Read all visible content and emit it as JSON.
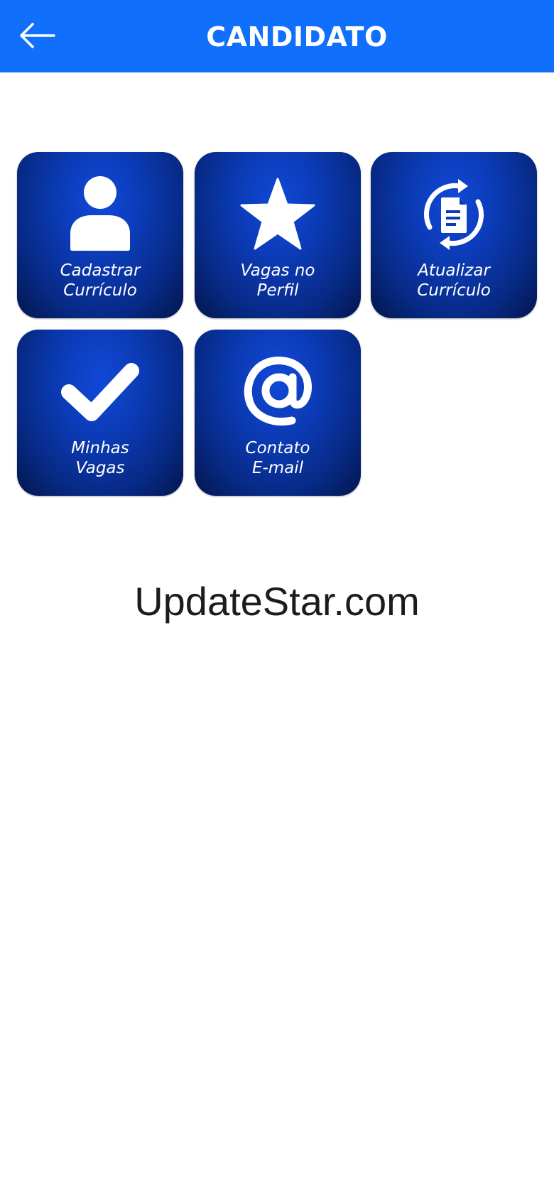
{
  "header": {
    "title": "CANDIDATO",
    "back_icon": "arrow-left-icon",
    "background_color": "#1070fb"
  },
  "tiles": [
    {
      "icon": "user-icon",
      "line1": "Cadastrar",
      "line2": "Currículo"
    },
    {
      "icon": "star-icon",
      "line1": "Vagas no",
      "line2": "Perfil"
    },
    {
      "icon": "refresh-document-icon",
      "line1": "Atualizar",
      "line2": "Currículo"
    },
    {
      "icon": "checkmark-icon",
      "line1": "Minhas",
      "line2": "Vagas"
    },
    {
      "icon": "at-sign-icon",
      "line1": "Contato",
      "line2": "E-mail"
    }
  ],
  "tile_color": "#0b3bb6",
  "footer": {
    "text": "UpdateStar.com"
  }
}
